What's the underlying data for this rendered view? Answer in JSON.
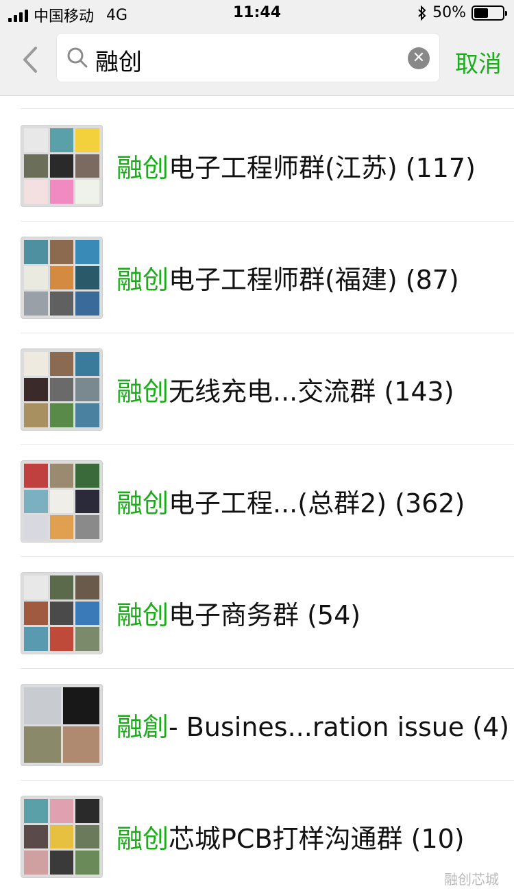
{
  "status_bar": {
    "carrier": "中国移动",
    "network": "4G",
    "time": "11:44",
    "battery": "50%",
    "battery_level": 0.5
  },
  "search": {
    "query": "融创",
    "cancel_label": "取消"
  },
  "colors": {
    "highlight": "#1aad19",
    "background": "#ffffff",
    "bar": "#f0f0f0"
  },
  "results": [
    {
      "highlight": "融创",
      "rest": "电子工程师群(江苏) (117)",
      "avatar_grid": 9,
      "avatar_colors": [
        "#e8e8e8",
        "#5aa0a8",
        "#f2d13c",
        "#6b6e58",
        "#2a2a2a",
        "#7a6a60",
        "#f4e0e0",
        "#f08ac0",
        "#eef2e8"
      ]
    },
    {
      "highlight": "融创",
      "rest": "电子工程师群(福建) (87)",
      "avatar_grid": 9,
      "avatar_colors": [
        "#4e8fa0",
        "#8c6a50",
        "#3a8ab8",
        "#eaeae0",
        "#d48a40",
        "#2a5a6a",
        "#9aa0a8",
        "#606060",
        "#3a6a9a"
      ]
    },
    {
      "highlight": "融创",
      "rest": "无线充电...交流群 (143)",
      "avatar_grid": 9,
      "avatar_colors": [
        "#eeeae0",
        "#8a6a50",
        "#3a7a9a",
        "#3a2a2a",
        "#6a6a6a",
        "#7a8890",
        "#a89060",
        "#5a8a4a",
        "#4a80a0"
      ]
    },
    {
      "highlight": "融创",
      "rest": "电子工程...(总群2) (362)",
      "avatar_grid": 9,
      "avatar_colors": [
        "#c04040",
        "#9a8a70",
        "#3a6a3a",
        "#7ab0c0",
        "#f0eee8",
        "#2a2a3a",
        "#d8d8e0",
        "#e0a050",
        "#8a8a8a"
      ]
    },
    {
      "highlight": "融创",
      "rest": "电子商务群 (54)",
      "avatar_grid": 9,
      "avatar_colors": [
        "#e8e8e8",
        "#5a6a4a",
        "#6a5a4a",
        "#a05a40",
        "#4a4a4a",
        "#3a7ab8",
        "#5a9ab0",
        "#c04a3a",
        "#7a8a6a"
      ]
    },
    {
      "highlight": "融創",
      "rest": "- Busines...ration issue (4)",
      "avatar_grid": 4,
      "avatar_colors": [
        "#c8ccd0",
        "#181818",
        "#8a8a6a",
        "#b08a70"
      ]
    },
    {
      "highlight": "融创",
      "rest": "芯城PCB打样沟通群 (10)",
      "avatar_grid": 9,
      "avatar_colors": [
        "#5aa0a8",
        "#e0a0b0",
        "#2a2a2a",
        "#5a4a4a",
        "#e8c040",
        "#6a7a5a",
        "#d0a0a0",
        "#3a3a3a",
        "#6a8a5a"
      ]
    }
  ],
  "watermark": "融创芯城"
}
